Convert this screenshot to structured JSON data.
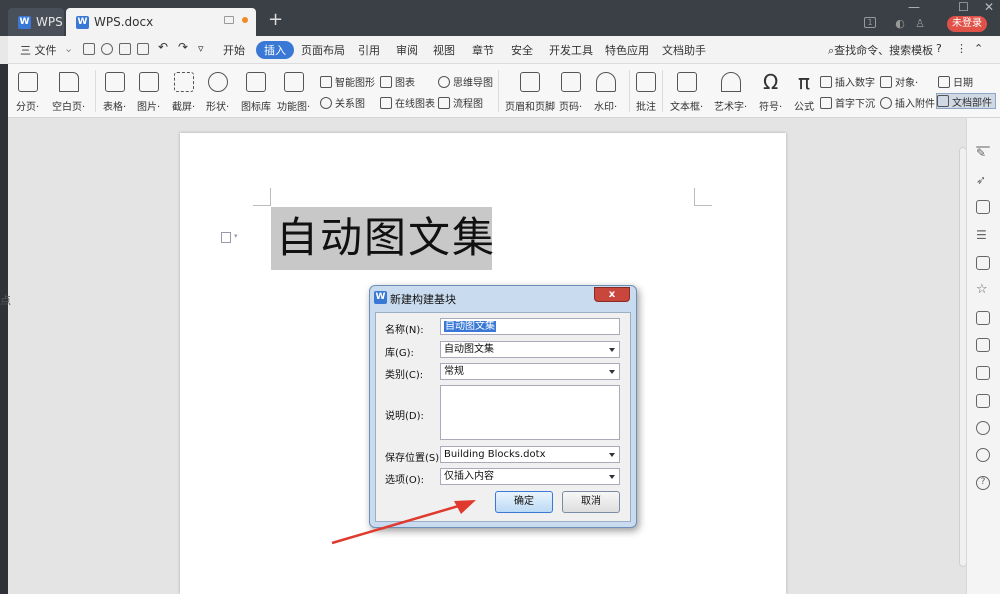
{
  "titlebar": {
    "app_tab_label": "WPS",
    "doc_tab_label": "WPS.docx",
    "login_label": "未登录"
  },
  "menu": {
    "file_label": "三 文件",
    "items": [
      "开始",
      "插入",
      "页面布局",
      "引用",
      "审阅",
      "视图",
      "章节",
      "安全",
      "开发工具",
      "特色应用",
      "文档助手"
    ],
    "active": "插入",
    "search_label": "查找命令、搜索模板",
    "help_label": "?"
  },
  "ribbon": {
    "page_break": "分页·",
    "blank_page": "空白页·",
    "table": "表格·",
    "picture": "图片·",
    "screenshot": "截屏·",
    "shape": "形状·",
    "icon_lib": "图标库",
    "function_chart": "功能图·",
    "smart_shape": "智能图形",
    "chart": "图表",
    "mind_map": "思维导图",
    "relation_chart": "关系图",
    "online_chart": "在线图表",
    "flow_chart": "流程图",
    "header_footer": "页眉和页脚",
    "page_number": "页码·",
    "watermark": "水印·",
    "comment": "批注",
    "textbox": "文本框·",
    "wordart": "艺术字·",
    "symbol": "符号·",
    "formula": "公式",
    "insert_number": "插入数字",
    "object": "对象·",
    "date": "日期",
    "drop_cap": "首字下沉",
    "attachment": "插入附件",
    "doc_parts": "文档部件"
  },
  "document": {
    "text": "自动图文集",
    "left_char": "点"
  },
  "dialog": {
    "title": "新建构建基块",
    "close_label": "x",
    "name_label": "名称(N):",
    "name_value": "自动图文集",
    "gallery_label": "库(G):",
    "gallery_value": "自动图文集",
    "category_label": "类别(C):",
    "category_value": "常规",
    "description_label": "说明(D):",
    "description_value": "",
    "save_in_label": "保存位置(S):",
    "save_in_value": "Building Blocks.dotx",
    "options_label": "选项(O):",
    "options_value": "仅插入内容",
    "ok_label": "确定",
    "cancel_label": "取消"
  },
  "colors": {
    "accent": "#3a78d6",
    "titlebar": "#3b4047",
    "login_red": "#e05247",
    "annotation_arrow": "#e03a2e"
  }
}
